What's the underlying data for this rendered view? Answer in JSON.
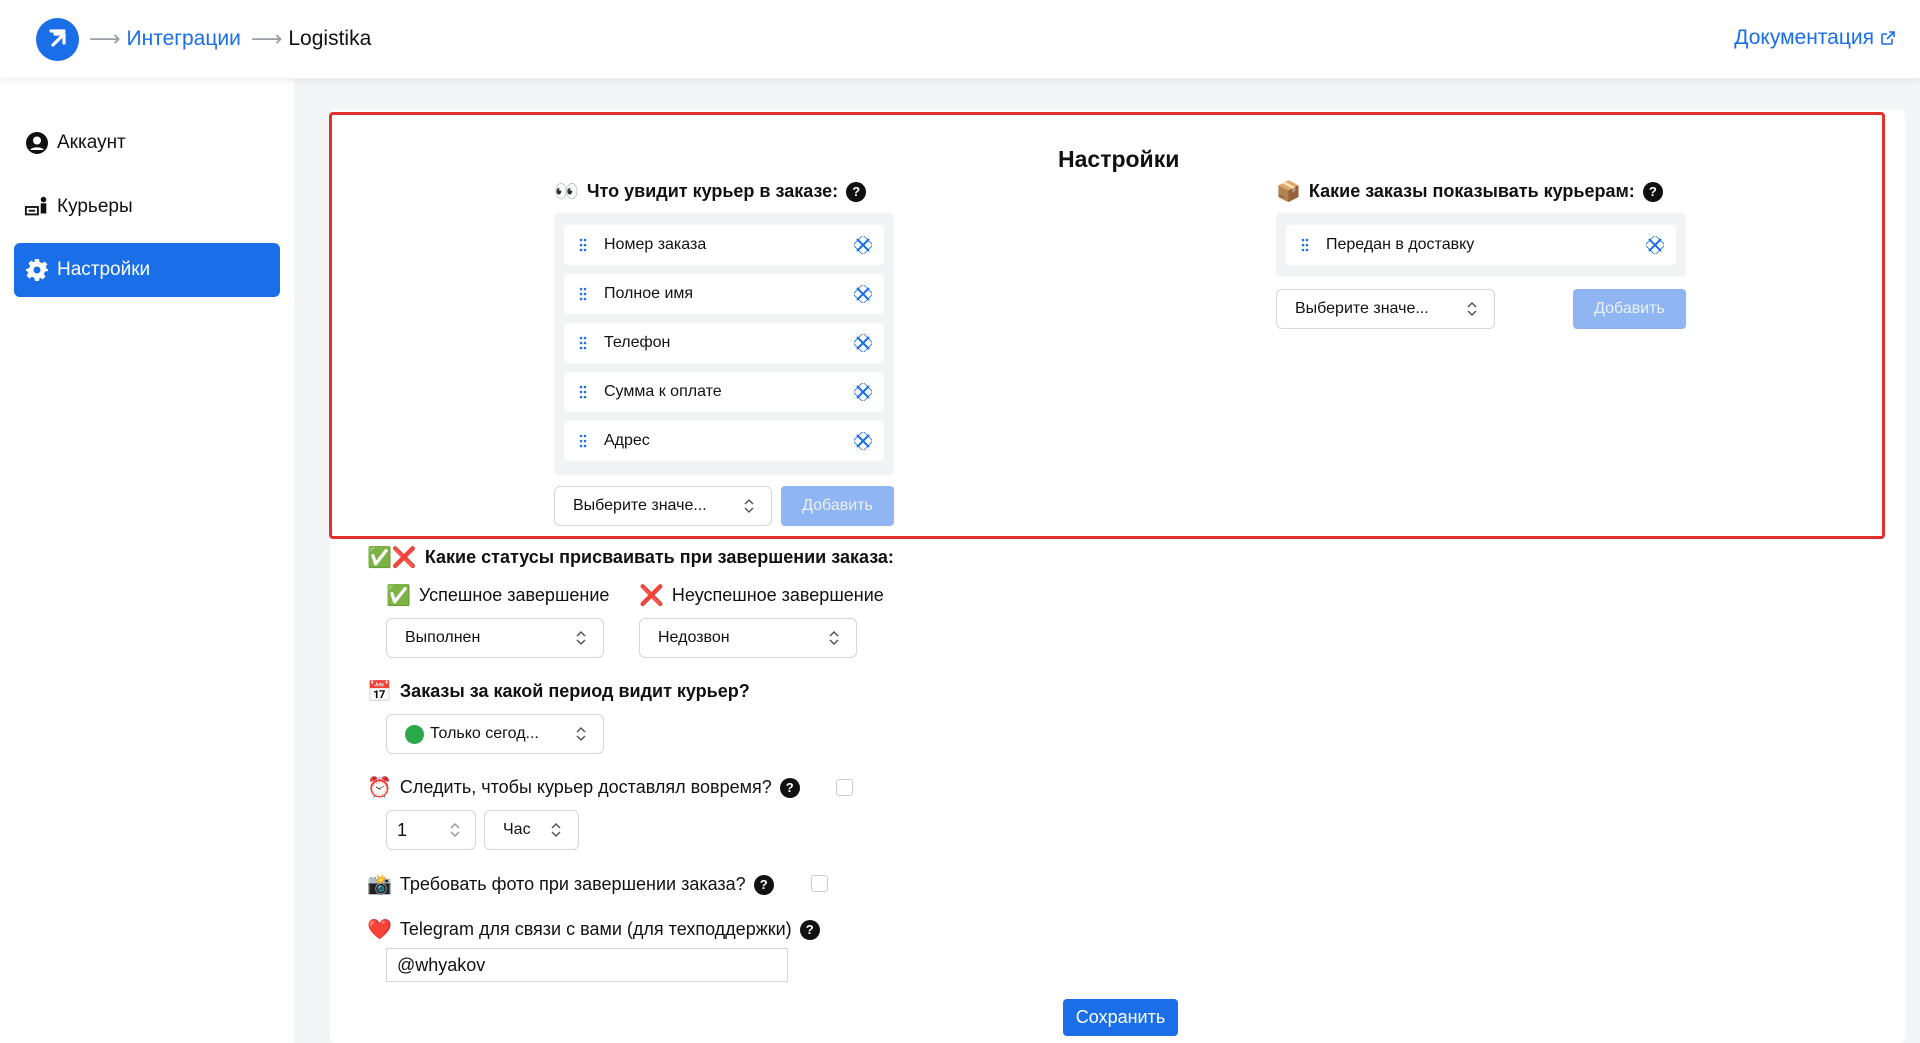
{
  "header": {
    "breadcrumb": [
      "Интеграции",
      "Logistika"
    ],
    "docs_label": "Документация"
  },
  "sidebar": {
    "items": [
      {
        "label": "Аккаунт",
        "icon": "user-circle-icon"
      },
      {
        "label": "Курьеры",
        "icon": "courier-icon"
      },
      {
        "label": "Настройки",
        "icon": "gear-icon",
        "active": true
      }
    ]
  },
  "settings": {
    "title": "Настройки",
    "fields_section": {
      "heading_emoji": "👀",
      "heading": "Что увидит курьер в заказе:",
      "items": [
        "Номер заказа",
        "Полное имя",
        "Телефон",
        "Сумма к оплате",
        "Адрес"
      ],
      "select_placeholder": "Выберите значе...",
      "add_label": "Добавить"
    },
    "orders_section": {
      "heading_emoji": "📦",
      "heading": "Какие заказы показывать курьерам:",
      "items": [
        "Передан в доставку"
      ],
      "select_placeholder": "Выберите значе...",
      "add_label": "Добавить"
    },
    "statuses": {
      "heading_emoji": "✅❌",
      "heading": "Какие статусы присваивать при завершении заказа:",
      "success_emoji": "✅",
      "success_label": "Успешное завершение",
      "success_value": "Выполнен",
      "fail_emoji": "❌",
      "fail_label": "Неуспешное завершение",
      "fail_value": "Недозвон"
    },
    "period": {
      "heading_emoji": "📅",
      "heading": "Заказы за какой период видит курьер?",
      "value": "Только сегод..."
    },
    "timing": {
      "emoji": "⏰",
      "label": "Следить, чтобы курьер доставлял вовремя?",
      "checked": false,
      "amount": "1",
      "unit": "Час"
    },
    "photo": {
      "emoji": "📸",
      "label": "Требовать фото при завершении заказа?",
      "checked": false
    },
    "telegram": {
      "emoji": "❤️",
      "label": "Telegram для связи с вами (для техподдержки)",
      "value": "@whyakov"
    },
    "help_glyph": "?",
    "save_label": "Сохранить"
  },
  "colors": {
    "accent": "#1a6ee8",
    "highlight": "#e2302f",
    "button_disabled": "#8fb6f2"
  }
}
